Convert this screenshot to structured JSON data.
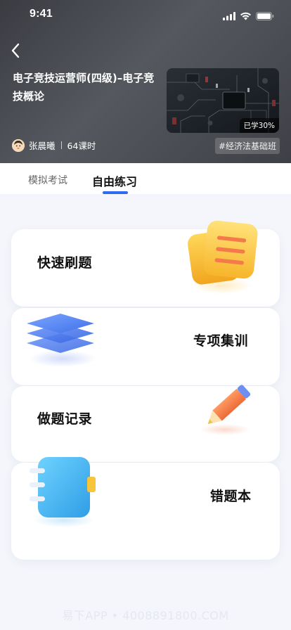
{
  "status_bar": {
    "time": "9:41"
  },
  "course": {
    "title": "电子竞技运营师(四级)–电子竞技概论",
    "progress": "已学30%",
    "teacher": "张晨曦",
    "lessons": "64课时",
    "class_tag": "#经济法基础班"
  },
  "tabs": [
    {
      "label": "模拟考试"
    },
    {
      "label": "自由练习"
    }
  ],
  "cards": [
    {
      "label": "快速刷题",
      "icon": "notes-icon"
    },
    {
      "label": "专项集训",
      "icon": "layers-icon"
    },
    {
      "label": "做题记录",
      "icon": "pencil-icon"
    },
    {
      "label": "错题本",
      "icon": "notebook-icon"
    }
  ],
  "watermark": "易下APP • 4008891800.COM",
  "colors": {
    "accent": "#2f6bf0",
    "card_bg": "#ffffff",
    "page_bg": "#f4f6fb"
  }
}
